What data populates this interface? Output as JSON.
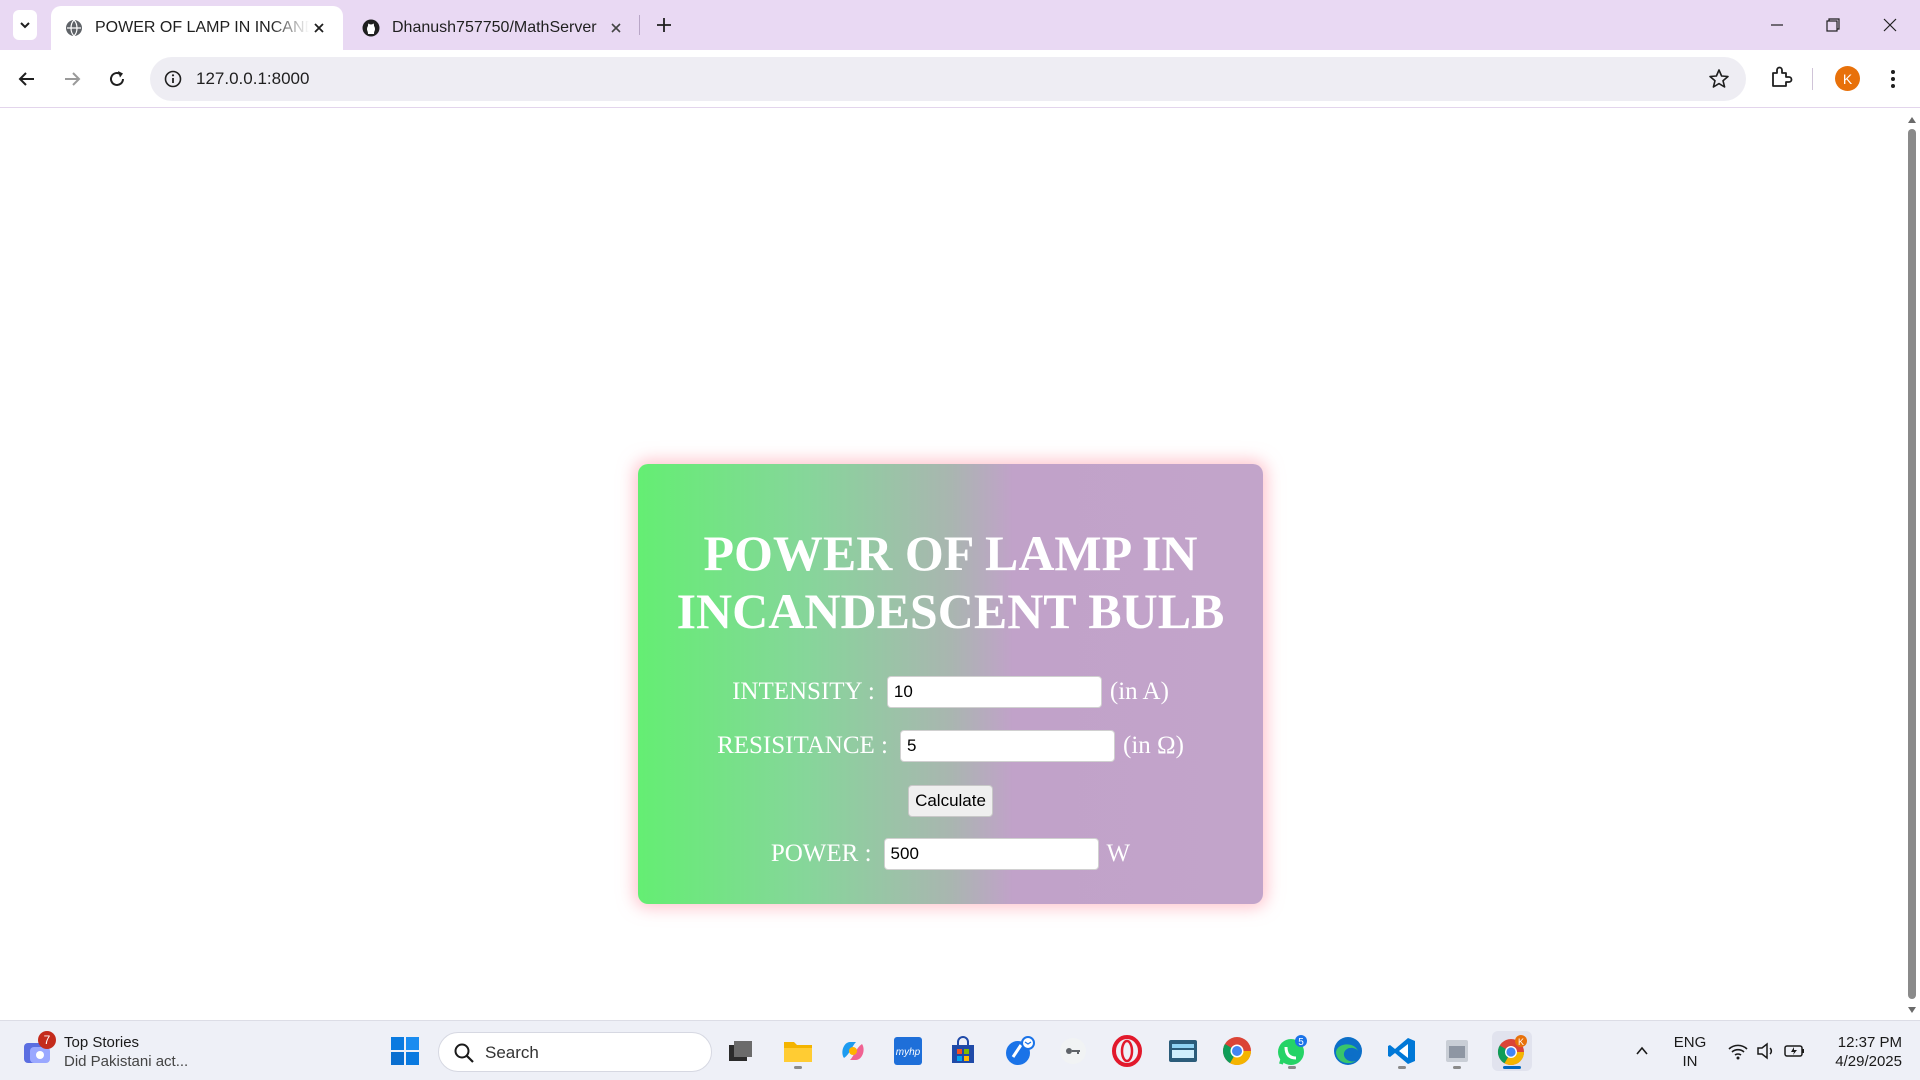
{
  "browser": {
    "tabs": [
      {
        "title": "POWER OF LAMP IN INCANDESCENT BULB",
        "active": true
      },
      {
        "title": "Dhanush757750/MathServer",
        "active": false
      }
    ],
    "url": "127.0.0.1:8000",
    "profile_initial": "K"
  },
  "page": {
    "heading": "POWER OF LAMP IN INCANDESCENT BULB",
    "intensity": {
      "label": "INTENSITY :",
      "value": "10",
      "unit": "(in A)"
    },
    "resistance": {
      "label": "RESISITANCE :",
      "value": "5",
      "unit": "(in Ω)"
    },
    "calculate_label": "Calculate",
    "power": {
      "label": "POWER :",
      "value": "500",
      "unit": "W"
    },
    "colors": {
      "gradient_start": "#64ee73",
      "gradient_end": "#c2a4ca",
      "glow": "#ff96a5"
    }
  },
  "taskbar": {
    "news": {
      "title": "Top Stories",
      "subtitle": "Did Pakistani act...",
      "badge": "7"
    },
    "search_placeholder": "Search",
    "whatsapp_badge": "5",
    "chrome_badge": "K",
    "lang_line1": "ENG",
    "lang_line2": "IN",
    "time": "12:37 PM",
    "date": "4/29/2025"
  }
}
